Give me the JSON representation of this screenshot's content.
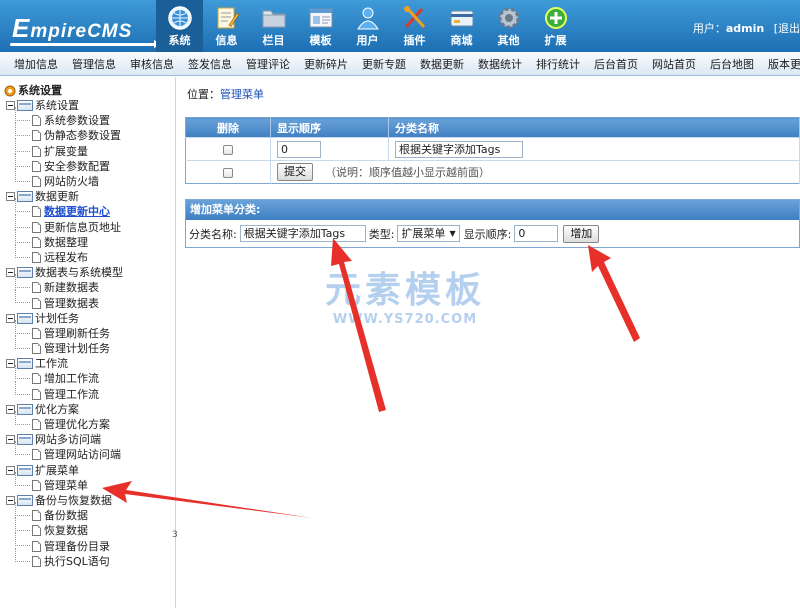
{
  "colors": {
    "header": "#2a82c8",
    "accent_arrow": "#e8302a",
    "link": "#1d4fb5"
  },
  "logo": {
    "first": "E",
    "rest": "mpireCMS"
  },
  "mainnav": [
    {
      "label": "系统",
      "icon": "globe-icon",
      "active": true
    },
    {
      "label": "信息",
      "icon": "edit-icon"
    },
    {
      "label": "栏目",
      "icon": "folder-icon"
    },
    {
      "label": "模板",
      "icon": "template-icon"
    },
    {
      "label": "用户",
      "icon": "user-icon"
    },
    {
      "label": "插件",
      "icon": "tools-icon"
    },
    {
      "label": "商城",
      "icon": "card-icon"
    },
    {
      "label": "其他",
      "icon": "gear-icon"
    },
    {
      "label": "扩展",
      "icon": "plus-icon"
    }
  ],
  "userinfo": {
    "prefix": "用户：",
    "name": "admin",
    "logout": "[退出"
  },
  "toolbar": [
    "增加信息",
    "管理信息",
    "审核信息",
    "签发信息",
    "管理评论",
    "更新碎片",
    "更新专题",
    "数据更新",
    "数据统计",
    "排行统计",
    "后台首页",
    "网站首页",
    "后台地图",
    "版本更新"
  ],
  "sidebar": {
    "root": "系统设置",
    "groups": [
      {
        "label": "系统设置",
        "items": [
          "系统参数设置",
          "伪静态参数设置",
          "扩展变量",
          "安全参数配置",
          "网站防火墙"
        ]
      },
      {
        "label": "数据更新",
        "items": [
          "数据更新中心",
          "更新信息页地址",
          "数据整理",
          "远程发布"
        ]
      },
      {
        "label": "数据表与系统模型",
        "items": [
          "新建数据表",
          "管理数据表"
        ]
      },
      {
        "label": "计划任务",
        "items": [
          "管理刷新任务",
          "管理计划任务"
        ]
      },
      {
        "label": "工作流",
        "items": [
          "增加工作流",
          "管理工作流"
        ]
      },
      {
        "label": "优化方案",
        "items": [
          "管理优化方案"
        ]
      },
      {
        "label": "网站多访问端",
        "items": [
          "管理网站访问端"
        ]
      },
      {
        "label": "扩展菜单",
        "items": [
          "管理菜单"
        ]
      },
      {
        "label": "备份与恢复数据",
        "items": [
          "备份数据",
          "恢复数据",
          "管理备份目录",
          "执行SQL语句"
        ]
      }
    ],
    "current_item": "数据更新中心",
    "marker": "3"
  },
  "breadcrumb": {
    "prefix": "位置：",
    "link": "管理菜单"
  },
  "list_table": {
    "headers": [
      "删除",
      "显示顺序",
      "分类名称"
    ],
    "row": {
      "order": "0",
      "name": "根据关键字添加Tags"
    },
    "submit_label": "提交",
    "hint": "（说明：顺序值越小显示越前面）"
  },
  "add_form": {
    "title": "增加菜单分类:",
    "name_label": "分类名称:",
    "name_value": "根据关键字添加Tags",
    "type_label": "类型:",
    "type_value": "扩展菜单",
    "order_label": "显示顺序:",
    "order_value": "0",
    "add_label": "增加"
  },
  "watermark": {
    "big": "元素模板",
    "small": "WWW.YS720.COM"
  }
}
